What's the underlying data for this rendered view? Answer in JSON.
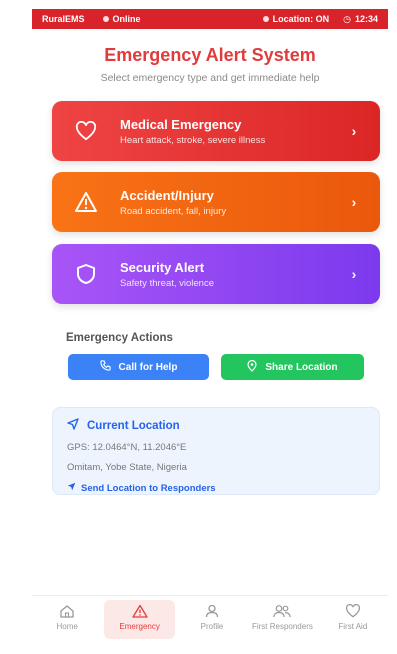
{
  "status_bar": {
    "app_name": "RuralEMS",
    "connection": "Online",
    "location_status": "Location: ON",
    "time": "12:34"
  },
  "header": {
    "title": "Emergency Alert System",
    "subtitle": "Select emergency type and get immediate help"
  },
  "alerts": [
    {
      "title": "Medical Emergency",
      "desc": "Heart attack, stroke, severe illness",
      "icon": "heart-icon",
      "color": "#dc2626"
    },
    {
      "title": "Accident/Injury",
      "desc": "Road accident, fall, injury",
      "icon": "warning-triangle-icon",
      "color": "#ea580c"
    },
    {
      "title": "Security Alert",
      "desc": "Safety threat, violence",
      "icon": "shield-icon",
      "color": "#7c3aed"
    }
  ],
  "actions": {
    "title": "Emergency Actions",
    "call_label": "Call for Help",
    "share_label": "Share Location"
  },
  "location": {
    "title": "Current Location",
    "gps": "GPS: 12.0464°N, 11.2046°E",
    "address": "Omitam, Yobe State, Nigeria",
    "send_label": "Send Location to Responders"
  },
  "nav": [
    {
      "label": "Home",
      "icon": "home-icon",
      "active": false
    },
    {
      "label": "Emergency",
      "icon": "alert-triangle-icon",
      "active": true
    },
    {
      "label": "Profile",
      "icon": "user-icon",
      "active": false
    },
    {
      "label": "First Responders",
      "icon": "users-icon",
      "active": false
    },
    {
      "label": "First Aid",
      "icon": "heart-outline-icon",
      "active": false
    }
  ]
}
